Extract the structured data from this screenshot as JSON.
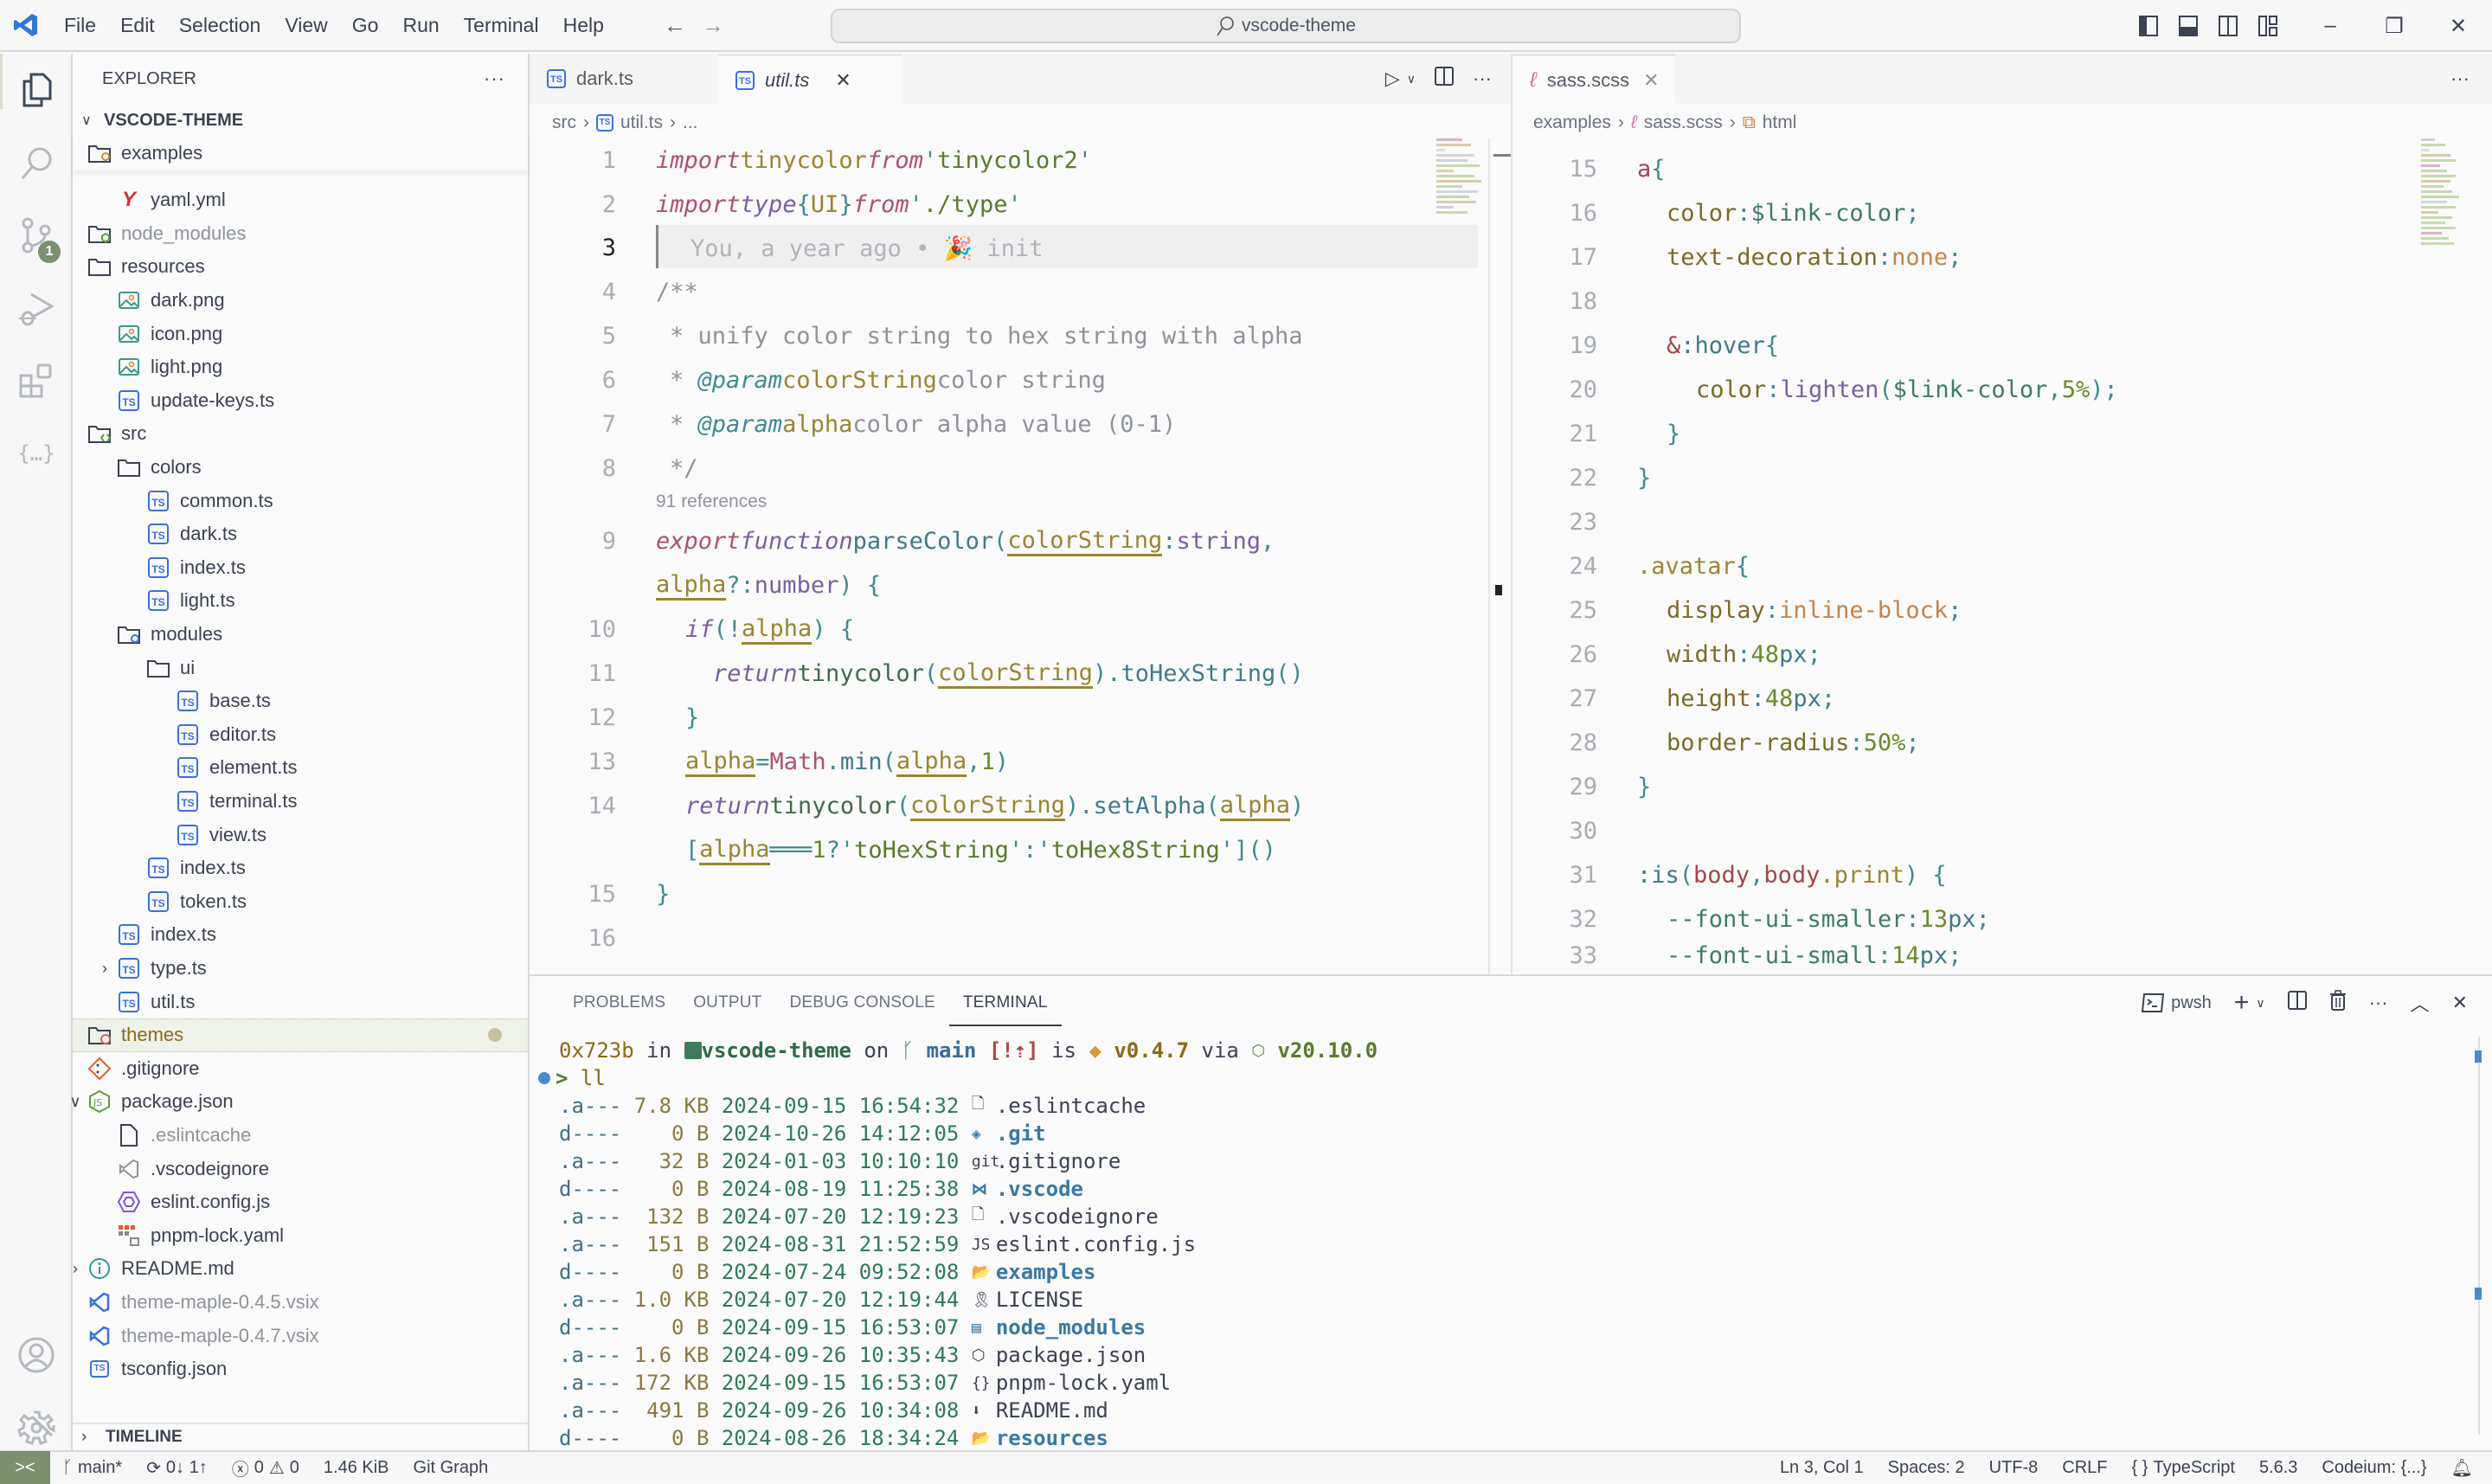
{
  "titlebar": {
    "menu": [
      "File",
      "Edit",
      "Selection",
      "View",
      "Go",
      "Run",
      "Terminal",
      "Help"
    ],
    "search_text": "vscode-theme",
    "window_controls": [
      "toggle-primary-sidebar",
      "toggle-panel",
      "toggle-secondary-sidebar",
      "customize-layout",
      "minimize",
      "restore",
      "close"
    ]
  },
  "activitybar": {
    "items": [
      "explorer",
      "search",
      "source-control",
      "run-and-debug",
      "extensions",
      "json-viewer"
    ],
    "source_control_badge": "1",
    "bottom": [
      "accounts",
      "manage"
    ]
  },
  "sidebar": {
    "title": "EXPLORER",
    "more": "···",
    "root": "VSCODE-THEME",
    "tree": [
      {
        "label": "examples",
        "depth": 0,
        "icon": "folder-examples-icon",
        "sticky": true
      },
      {
        "label": "yaml.yml",
        "depth": 1,
        "icon": "yaml-icon"
      },
      {
        "label": "node_modules",
        "depth": 0,
        "icon": "folder-node-icon",
        "dim": true
      },
      {
        "label": "resources",
        "depth": 0,
        "icon": "folder-icon"
      },
      {
        "label": "dark.png",
        "depth": 1,
        "icon": "image-icon"
      },
      {
        "label": "icon.png",
        "depth": 1,
        "icon": "image-icon"
      },
      {
        "label": "light.png",
        "depth": 1,
        "icon": "image-icon"
      },
      {
        "label": "update-keys.ts",
        "depth": 1,
        "icon": "ts-icon"
      },
      {
        "label": "src",
        "depth": 0,
        "icon": "folder-src-icon"
      },
      {
        "label": "colors",
        "depth": 1,
        "icon": "folder-icon"
      },
      {
        "label": "common.ts",
        "depth": 2,
        "icon": "ts-icon"
      },
      {
        "label": "dark.ts",
        "depth": 2,
        "icon": "ts-icon"
      },
      {
        "label": "index.ts",
        "depth": 2,
        "icon": "ts-icon"
      },
      {
        "label": "light.ts",
        "depth": 2,
        "icon": "ts-icon"
      },
      {
        "label": "modules",
        "depth": 1,
        "icon": "folder-modules-icon"
      },
      {
        "label": "ui",
        "depth": 2,
        "icon": "folder-icon"
      },
      {
        "label": "base.ts",
        "depth": 3,
        "icon": "ts-icon"
      },
      {
        "label": "editor.ts",
        "depth": 3,
        "icon": "ts-icon"
      },
      {
        "label": "element.ts",
        "depth": 3,
        "icon": "ts-icon"
      },
      {
        "label": "terminal.ts",
        "depth": 3,
        "icon": "ts-icon"
      },
      {
        "label": "view.ts",
        "depth": 3,
        "icon": "ts-icon"
      },
      {
        "label": "index.ts",
        "depth": 2,
        "icon": "ts-icon"
      },
      {
        "label": "token.ts",
        "depth": 2,
        "icon": "ts-icon"
      },
      {
        "label": "index.ts",
        "depth": 1,
        "icon": "ts-icon"
      },
      {
        "label": "type.ts",
        "depth": 1,
        "icon": "ts-icon",
        "chevron": ">"
      },
      {
        "label": "util.ts",
        "depth": 1,
        "icon": "ts-icon"
      },
      {
        "label": "themes",
        "depth": 0,
        "icon": "folder-themes-icon",
        "modified": true
      },
      {
        "label": ".gitignore",
        "depth": 0,
        "icon": "git-icon"
      },
      {
        "label": "package.json",
        "depth": 0,
        "icon": "nodejs-icon",
        "chevron": "v"
      },
      {
        "label": ".eslintcache",
        "depth": 1,
        "icon": "file-icon",
        "dim": true
      },
      {
        "label": ".vscodeignore",
        "depth": 1,
        "icon": "vscode-icon"
      },
      {
        "label": "eslint.config.js",
        "depth": 1,
        "icon": "eslint-icon"
      },
      {
        "label": "pnpm-lock.yaml",
        "depth": 1,
        "icon": "pnpm-icon"
      },
      {
        "label": "README.md",
        "depth": 0,
        "icon": "info-icon",
        "chevron": ">"
      },
      {
        "label": "theme-maple-0.4.5.vsix",
        "depth": 0,
        "icon": "vsix-icon",
        "dim": true
      },
      {
        "label": "theme-maple-0.4.7.vsix",
        "depth": 0,
        "icon": "vsix-icon",
        "dim": true
      },
      {
        "label": "tsconfig.json",
        "depth": 0,
        "icon": "tsconfig-icon"
      }
    ],
    "timeline": "TIMELINE"
  },
  "editor1": {
    "tabs": [
      {
        "label": "dark.ts",
        "active": false
      },
      {
        "label": "util.ts",
        "active": true,
        "italic": true
      }
    ],
    "breadcrumb": [
      "src",
      "util.ts",
      "..."
    ],
    "blame": "You, a year ago • 🎉 init",
    "references": "91 references",
    "line_numbers": [
      "1",
      "2",
      "3",
      "4",
      "5",
      "6",
      "7",
      "8",
      "9",
      "",
      "10",
      "11",
      "12",
      "13",
      "14",
      "",
      "15",
      "16"
    ]
  },
  "editor2": {
    "tabs": [
      {
        "label": "sass.scss",
        "active": true
      }
    ],
    "breadcrumb": [
      "examples",
      "sass.scss",
      "html"
    ],
    "line_numbers": [
      "15",
      "16",
      "17",
      "18",
      "19",
      "20",
      "21",
      "22",
      "23",
      "24",
      "25",
      "26",
      "27",
      "28",
      "29",
      "30",
      "31",
      "32",
      "33"
    ]
  },
  "panel": {
    "tabs": [
      "PROBLEMS",
      "OUTPUT",
      "DEBUG CONSOLE",
      "TERMINAL"
    ],
    "active_tab": "TERMINAL",
    "shell": "pwsh",
    "prompt": {
      "pid": "0x723b",
      "in": "in",
      "dir": "vscode-theme",
      "on": "on",
      "branch": "main",
      "status": "[!⇡]",
      "is": "is",
      "version": "v0.4.7",
      "via": "via",
      "node": "v20.10.0"
    },
    "command": "ll",
    "listing": [
      {
        "mode": ".a---",
        "size": "7.8 KB",
        "date": "2024-09-15",
        "time": "16:54:32",
        "icon": "🗋",
        "name": ".eslintcache",
        "dir": false
      },
      {
        "mode": "d----",
        "size": "0 B",
        "date": "2024-10-26",
        "time": "14:12:05",
        "icon": "◈",
        "name": ".git",
        "dir": true
      },
      {
        "mode": ".a---",
        "size": "32 B",
        "date": "2024-01-03",
        "time": "10:10:10",
        "icon": "git",
        "name": ".gitignore",
        "dir": false
      },
      {
        "mode": "d----",
        "size": "0 B",
        "date": "2024-08-19",
        "time": "11:25:38",
        "icon": "⋈",
        "name": ".vscode",
        "dir": true
      },
      {
        "mode": ".a---",
        "size": "132 B",
        "date": "2024-07-20",
        "time": "12:19:23",
        "icon": "🗋",
        "name": ".vscodeignore",
        "dir": false
      },
      {
        "mode": ".a---",
        "size": "151 B",
        "date": "2024-08-31",
        "time": "21:52:59",
        "icon": "JS",
        "name": "eslint.config.js",
        "dir": false
      },
      {
        "mode": "d----",
        "size": "0 B",
        "date": "2024-07-24",
        "time": "09:52:08",
        "icon": "📂",
        "name": "examples",
        "dir": true
      },
      {
        "mode": ".a---",
        "size": "1.0 KB",
        "date": "2024-07-20",
        "time": "12:19:44",
        "icon": "🎗",
        "name": "LICENSE",
        "dir": false
      },
      {
        "mode": "d----",
        "size": "0 B",
        "date": "2024-09-15",
        "time": "16:53:07",
        "icon": "▤",
        "name": "node_modules",
        "dir": true
      },
      {
        "mode": ".a---",
        "size": "1.6 KB",
        "date": "2024-09-26",
        "time": "10:35:43",
        "icon": "⬡",
        "name": "package.json",
        "dir": false
      },
      {
        "mode": ".a---",
        "size": "172 KB",
        "date": "2024-09-15",
        "time": "16:53:07",
        "icon": "{}",
        "name": "pnpm-lock.yaml",
        "dir": false
      },
      {
        "mode": ".a---",
        "size": "491 B",
        "date": "2024-09-26",
        "time": "10:34:08",
        "icon": "⬇",
        "name": "README.md",
        "dir": false
      },
      {
        "mode": "d----",
        "size": "0 B",
        "date": "2024-08-26",
        "time": "18:34:24",
        "icon": "📂",
        "name": "resources",
        "dir": true
      }
    ]
  },
  "statusbar": {
    "branch": "main*",
    "sync": "0↓ 1↑",
    "errors": "0",
    "warnings": "0",
    "filesize": "1.46 KiB",
    "git_graph": "Git Graph",
    "position": "Ln 3, Col 1",
    "spaces": "Spaces: 2",
    "encoding": "UTF-8",
    "eol": "CRLF",
    "language": "TypeScript",
    "ts_version": "5.6.3",
    "codeium": "Codeium: {...}"
  },
  "colors": {
    "accent": "#7c8f6f",
    "ts_blue": "#3b6fe0",
    "keyword": "#b0506e",
    "variable": "#9a8531",
    "string": "#5a7a2c",
    "function": "#3f7a8a"
  }
}
